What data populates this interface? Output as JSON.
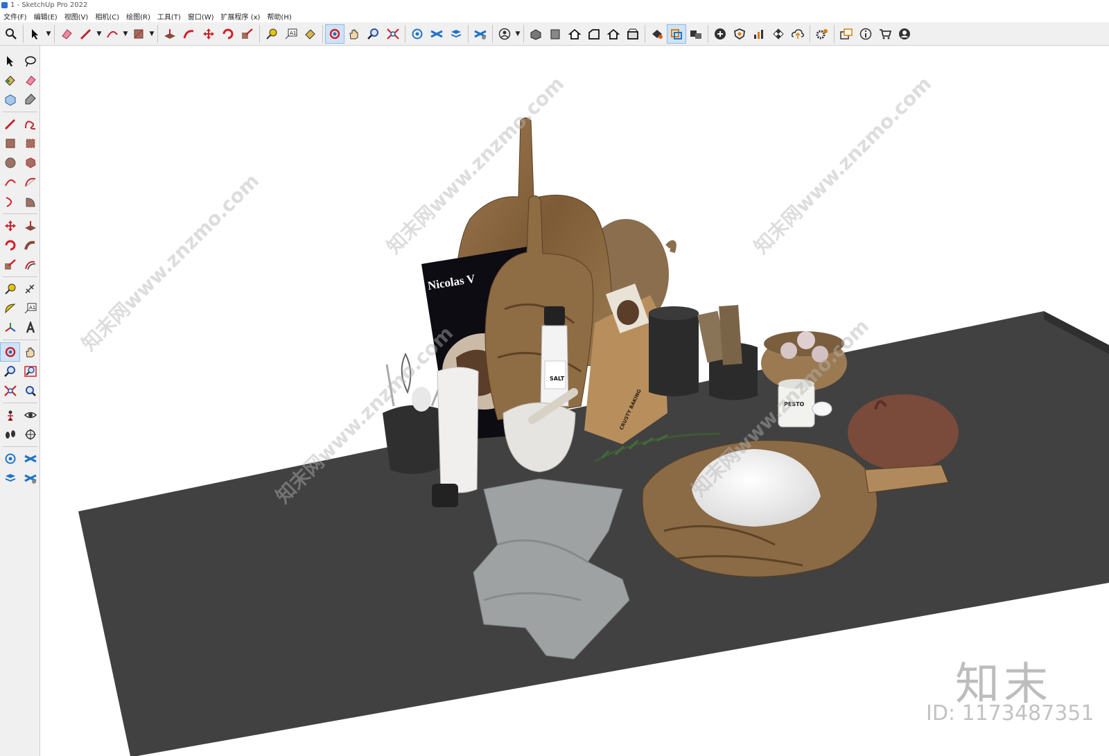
{
  "window": {
    "title": "1 - SketchUp Pro 2022"
  },
  "menu": [
    "文件(F)",
    "编辑(E)",
    "视图(V)",
    "相机(C)",
    "绘图(R)",
    "工具(T)",
    "窗口(W)",
    "扩展程序 (x)",
    "帮助(H)"
  ],
  "model": {
    "book_title": "Nicolas V",
    "salt_label": "SALT",
    "pesto_label": "PESTO",
    "bag_label": "CRUSTY BAKING"
  },
  "watermark": {
    "site": "知末网www.znzmo.com",
    "logo": "知末",
    "id": "ID: 1173487351"
  },
  "colors": {
    "table": "#414141",
    "wood": "#8a6a44",
    "toolbar_bg": "#f0f0f0"
  }
}
